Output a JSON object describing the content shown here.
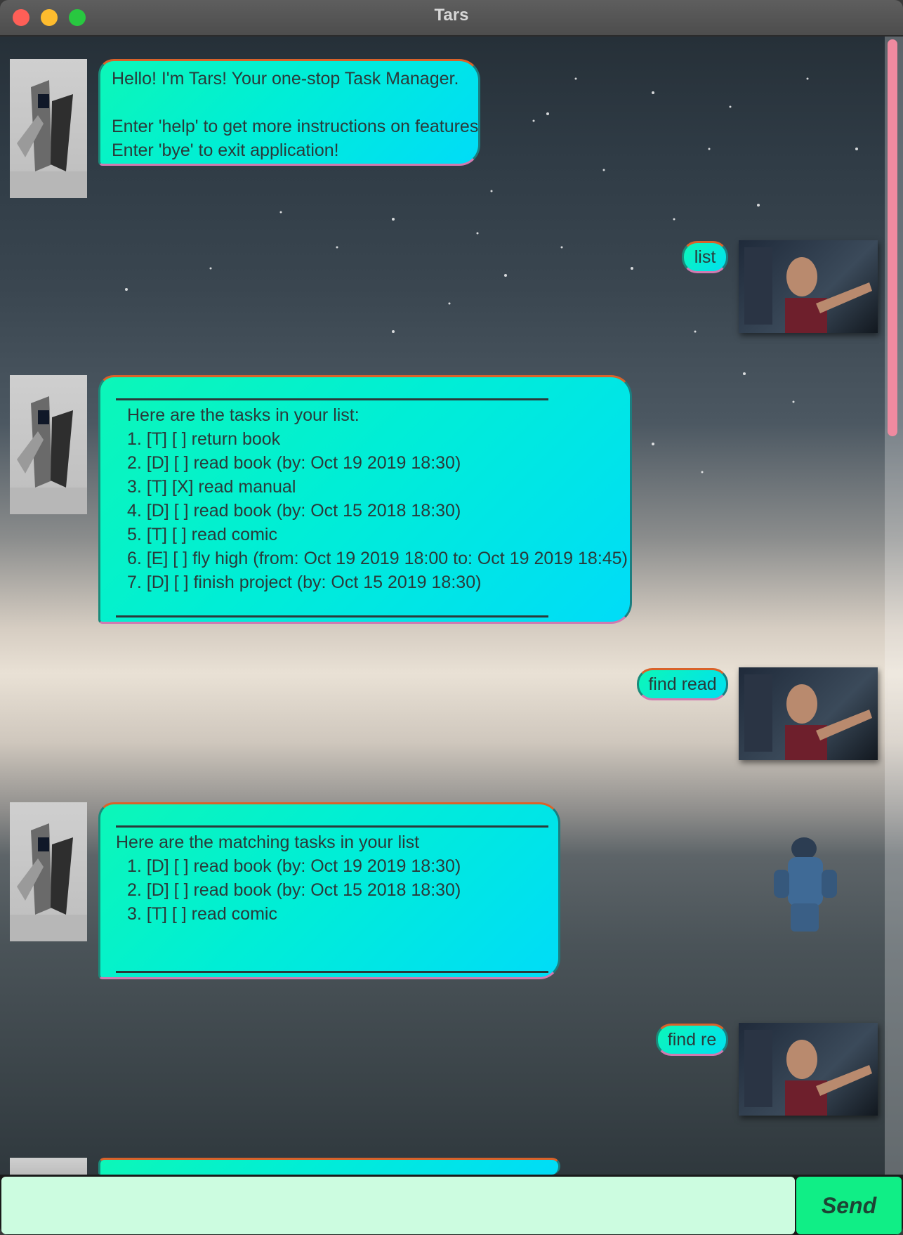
{
  "window": {
    "title": "Tars"
  },
  "messages": {
    "greeting": {
      "line1": "Hello! I'm Tars! Your one-stop Task Manager.",
      "line2": "Enter 'help' to get more instructions on features",
      "line3": "Enter 'bye' to exit application!"
    },
    "user1": "list",
    "list_reply": {
      "header": "Here are the tasks in your list:",
      "items": [
        "1. [T] [ ] return book",
        "2. [D] [ ] read book (by: Oct 19 2019 18:30)",
        "3. [T] [X] read manual",
        "4. [D] [ ] read book (by: Oct 15 2018 18:30)",
        "5. [T] [ ] read comic",
        "6. [E] [ ] fly high (from: Oct 19 2019 18:00 to: Oct 19 2019 18:45)",
        "7. [D] [ ] finish project (by: Oct 15 2019 18:30)"
      ]
    },
    "user2": "find read",
    "find_reply": {
      "header": "Here are the matching tasks in your list",
      "items": [
        "1. [D] [ ] read book (by: Oct 19 2019 18:30)",
        "2. [D] [ ] read book (by: Oct 15 2018 18:30)",
        "3. [T] [ ] read comic"
      ]
    },
    "user3": "find re"
  },
  "input": {
    "value": "",
    "placeholder": ""
  },
  "send": {
    "label": "Send"
  },
  "colors": {
    "bubble_start": "#0cf7b8",
    "bubble_end": "#00dcf8",
    "input_bg": "#ccfce0",
    "send_bg": "#10ee86",
    "scroll_thumb": "#f08aa0"
  }
}
